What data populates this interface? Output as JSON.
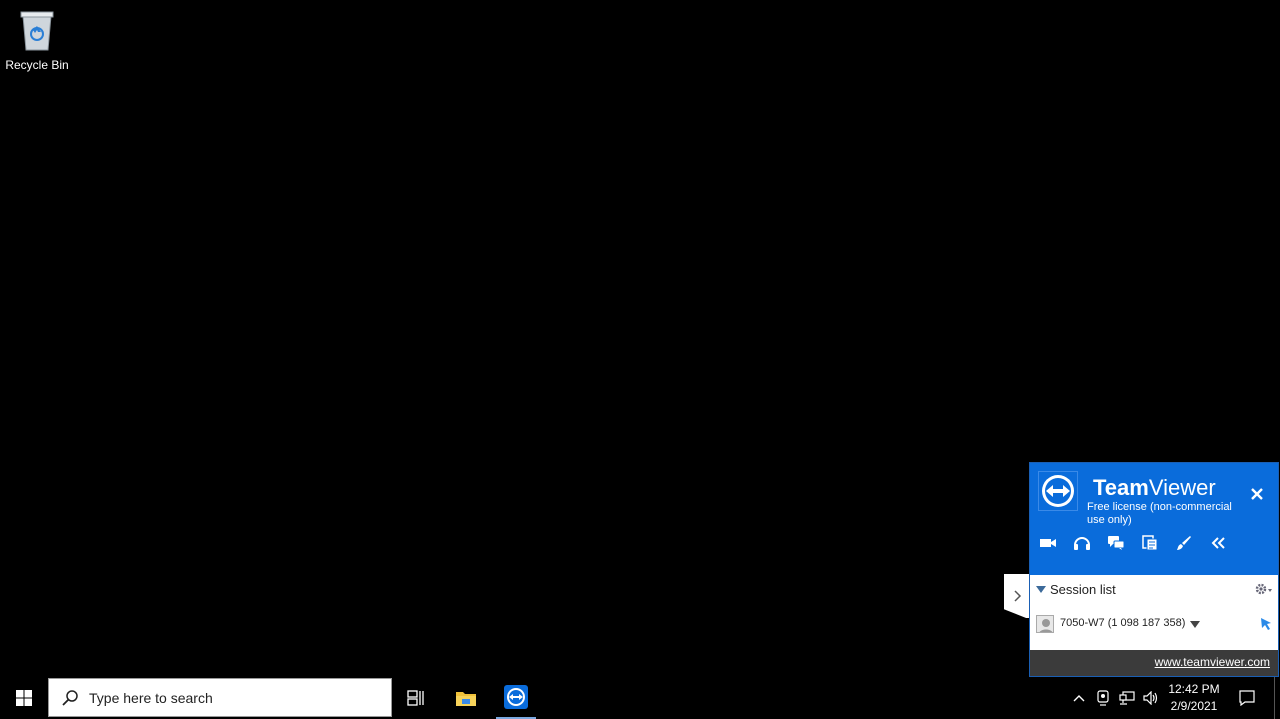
{
  "desktop": {
    "icons": [
      {
        "label": "Recycle Bin",
        "icon": "recycle-bin-icon"
      }
    ]
  },
  "teamviewer": {
    "title_bold": "Team",
    "title_normal": "Viewer",
    "license": "Free license (non-commercial use only)",
    "toolbar": [
      "video-icon",
      "headset-icon",
      "chat-icon",
      "file-transfer-icon",
      "whiteboard-icon",
      "collapse-icon"
    ],
    "session_list_label": "Session list",
    "session": {
      "name": "7050-W7 (1 098 187 358)"
    },
    "footer_link": "www.teamviewer.com",
    "colors": {
      "header": "#0a6cdb",
      "footer": "#3b3b3b"
    }
  },
  "taskbar": {
    "search_placeholder": "Type here to search",
    "apps": [
      "task-view-icon",
      "file-explorer-icon",
      "teamviewer-icon"
    ],
    "clock": {
      "time": "12:42 PM",
      "date": "2/9/2021"
    }
  }
}
